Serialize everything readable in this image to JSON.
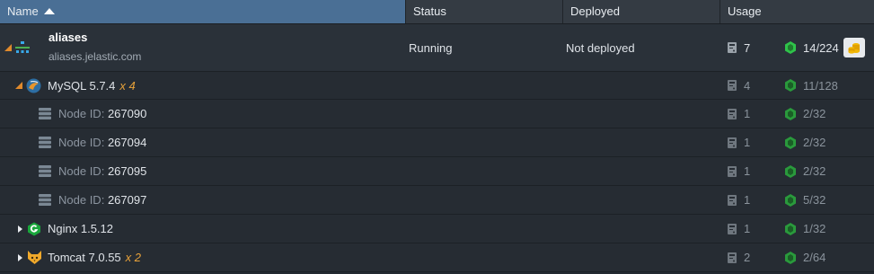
{
  "header": {
    "name": "Name",
    "status": "Status",
    "deployed": "Deployed",
    "usage": "Usage"
  },
  "environment": {
    "name": "aliases",
    "domain": "aliases.jelastic.com",
    "status": "Running",
    "deployed": "Not deployed",
    "disk": "7",
    "cloudlets": "14/224"
  },
  "mysql": {
    "name": "MySQL 5.7.4",
    "count": "x 4",
    "disk": "4",
    "cloudlets": "11/128",
    "nodes": [
      {
        "label": "Node ID:",
        "id": "267090",
        "disk": "1",
        "cloudlets": "2/32"
      },
      {
        "label": "Node ID:",
        "id": "267094",
        "disk": "1",
        "cloudlets": "2/32"
      },
      {
        "label": "Node ID:",
        "id": "267095",
        "disk": "1",
        "cloudlets": "2/32"
      },
      {
        "label": "Node ID:",
        "id": "267097",
        "disk": "1",
        "cloudlets": "5/32"
      }
    ]
  },
  "nginx": {
    "name": "Nginx 1.5.12",
    "disk": "1",
    "cloudlets": "1/32"
  },
  "tomcat": {
    "name": "Tomcat 7.0.55",
    "count": "x 2",
    "disk": "2",
    "cloudlets": "2/64"
  },
  "colors": {
    "header_active": "#4a6f95",
    "accent_orange": "#e08a2c",
    "cloudlet_green": "#2fc34a",
    "row_bg": "#242a31"
  }
}
